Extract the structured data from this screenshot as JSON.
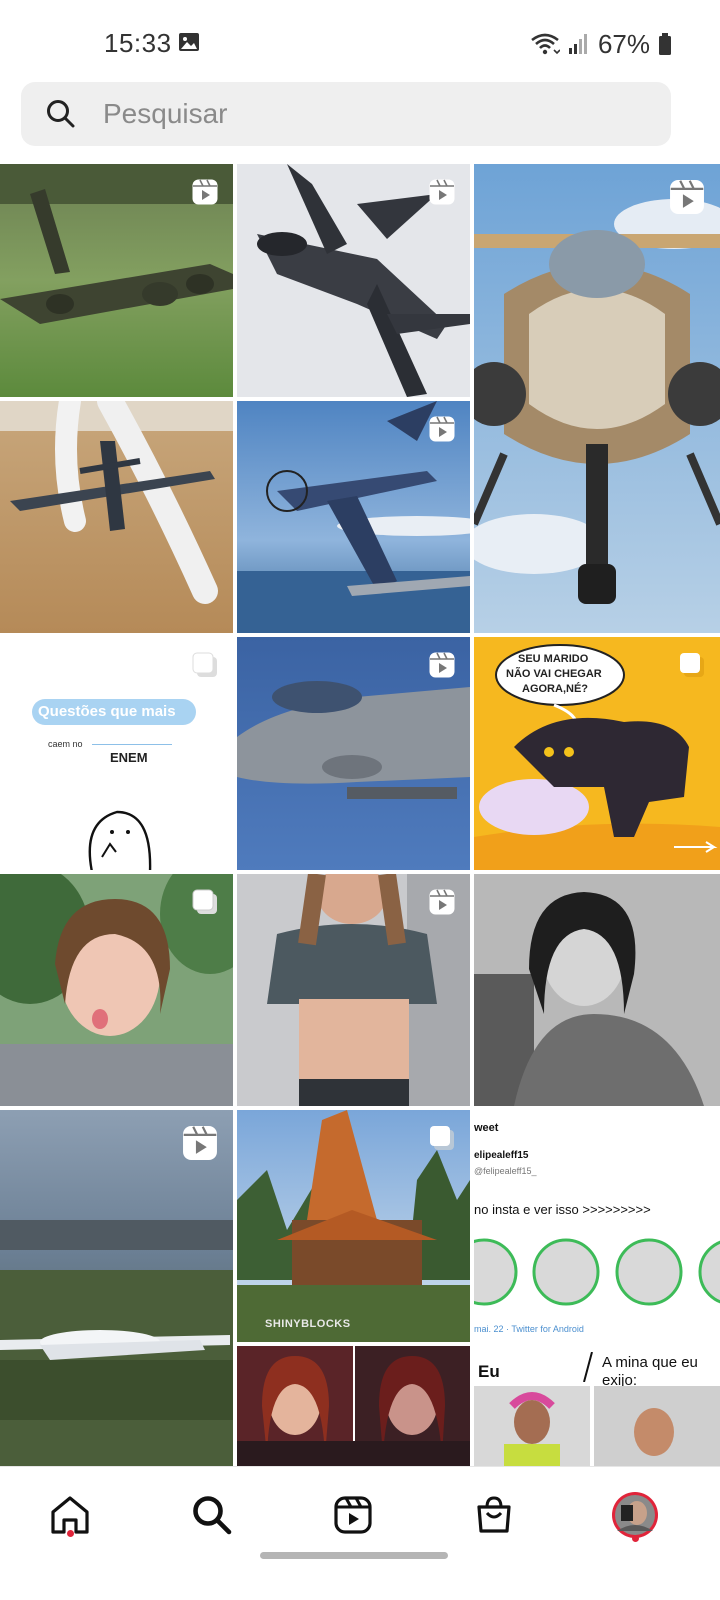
{
  "status_bar": {
    "time": "15:33",
    "battery": "67%",
    "icons": [
      "gallery-icon",
      "wifi-icon",
      "signal-icon",
      "battery-icon"
    ]
  },
  "search": {
    "placeholder": "Pesquisar"
  },
  "grid_tiles": [
    {
      "name": "tile-transport-plane",
      "badge": "reels-icon"
    },
    {
      "name": "tile-stealth-jet",
      "badge": "reels-icon"
    },
    {
      "name": "tile-jet-front-view",
      "badge": "reels-icon"
    },
    {
      "name": "tile-jet-smoke",
      "badge": "none"
    },
    {
      "name": "tile-propeller-plane",
      "badge": "reels-icon"
    },
    {
      "name": "tile-enem-post",
      "badge": "carousel-icon",
      "text_title": "Questões que mais",
      "text_sub": "caem no",
      "text_word": "ENEM"
    },
    {
      "name": "tile-fighter-jet",
      "badge": "reels-icon"
    },
    {
      "name": "tile-cat-comic",
      "badge": "carousel-icon",
      "text_bubble_1": "SEU MARIDO",
      "text_bubble_2": "NÃO VAI CHEGAR",
      "text_bubble_3": "AGORA,NÉ?"
    },
    {
      "name": "tile-girl-tongue",
      "badge": "carousel-icon"
    },
    {
      "name": "tile-girl-crop-top",
      "badge": "reels-icon"
    },
    {
      "name": "tile-girl-bw",
      "badge": "none"
    },
    {
      "name": "tile-antonov-plane",
      "badge": "reels-icon"
    },
    {
      "name": "tile-minecraft-house",
      "badge": "carousel-icon",
      "watermark": "SHINYBLOCKS"
    },
    {
      "name": "tile-tweet",
      "badge": "none",
      "tweet_header": "weet",
      "tweet_user": "elipealeff15",
      "tweet_handle": "@felipealeff15_",
      "tweet_text": "no insta e ver isso >>>>>>>>>",
      "tweet_footer": "mai. 22 · Twitter for Android"
    },
    {
      "name": "tile-scarlet-witch",
      "badge": "none"
    },
    {
      "name": "tile-meme-eu",
      "badge": "none",
      "left_label": "Eu",
      "right_label": "A mina que eu exijo:"
    }
  ],
  "bottom_nav": {
    "items": [
      "home-icon",
      "search-icon",
      "reels-icon",
      "shop-icon",
      "profile-avatar"
    ]
  },
  "colors": {
    "accent_red": "#e0243a",
    "search_bg": "#efefef"
  }
}
